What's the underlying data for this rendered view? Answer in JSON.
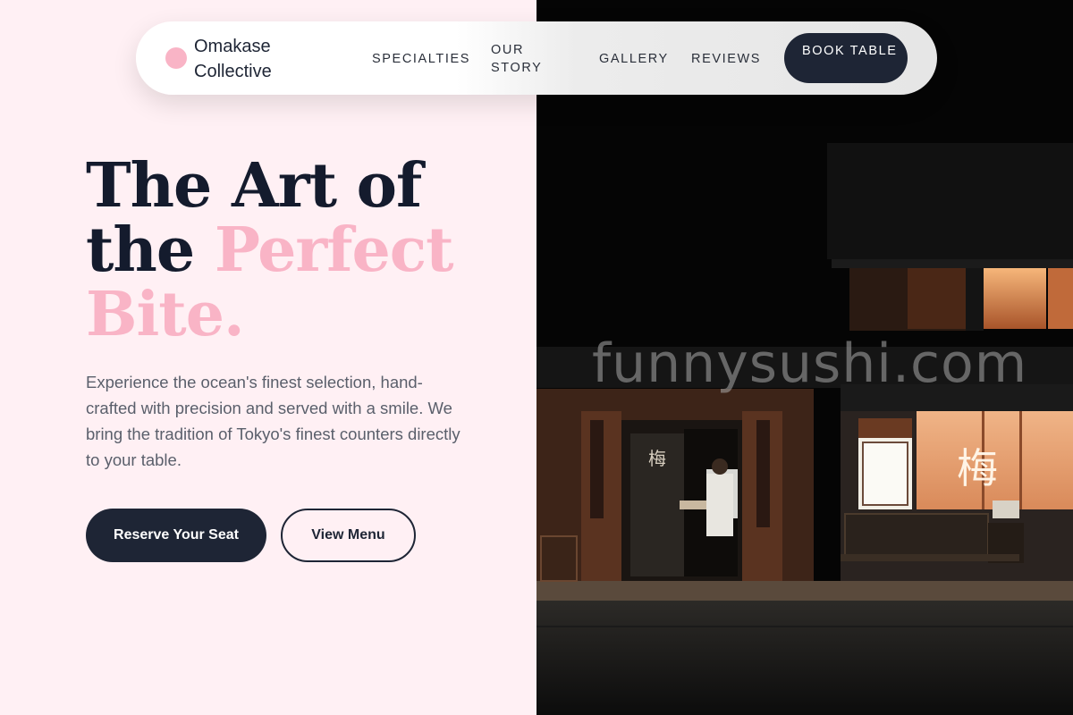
{
  "brand": {
    "name": "Omakase Collective",
    "dot_color": "#f9b4c6"
  },
  "nav": {
    "links": [
      "SPECIALTIES",
      "OUR STORY",
      "GALLERY",
      "REVIEWS"
    ],
    "cta": "BOOK TABLE"
  },
  "hero": {
    "title_line1": "The Art of",
    "title_line2_plain": "the",
    "title_line2_accent": "Perfect",
    "title_line3_accent": "Bite.",
    "description": "Experience the ocean's finest selection, hand-crafted with precision and served with a smile. We bring the tradition of Tokyo's finest counters directly to your table.",
    "primary_button": "Reserve Your Seat",
    "secondary_button": "View Menu"
  },
  "photo": {
    "watermark": "funnysushi.com",
    "sign_glyph": "梅"
  },
  "colors": {
    "accent": "#f9b4c6",
    "navy": "#1e2535",
    "background": "#fff0f4"
  }
}
